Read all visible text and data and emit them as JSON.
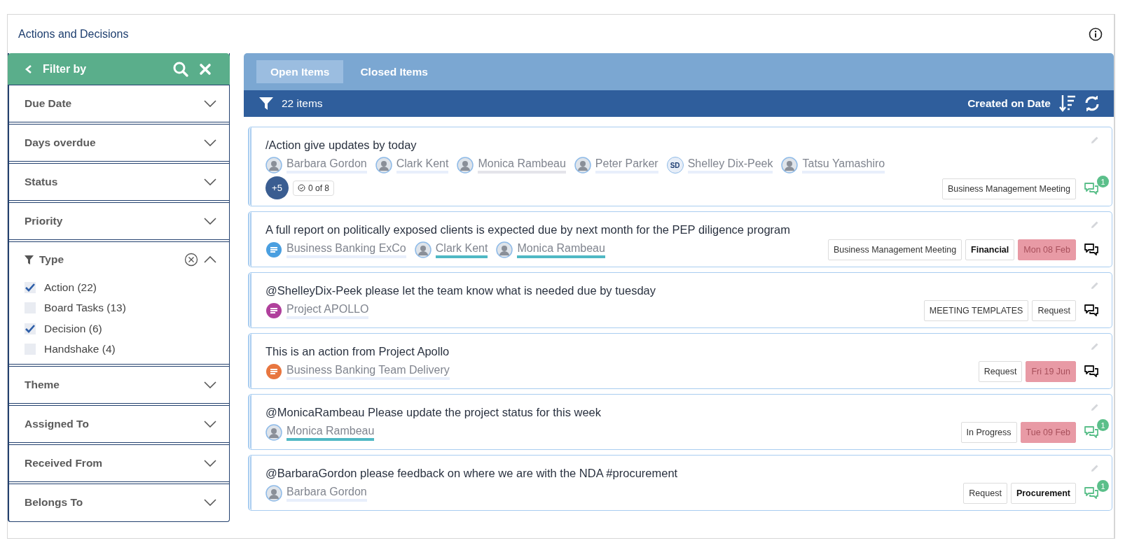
{
  "panel": {
    "title": "Actions and Decisions"
  },
  "filter": {
    "title": "Filter by",
    "sections": [
      {
        "label": "Due Date",
        "expanded": false
      },
      {
        "label": "Days overdue",
        "expanded": false
      },
      {
        "label": "Status",
        "expanded": false
      },
      {
        "label": "Priority",
        "expanded": false
      },
      {
        "label": "Type",
        "expanded": true,
        "options": [
          {
            "label": "Action (22)",
            "checked": true
          },
          {
            "label": "Board Tasks (13)",
            "checked": false
          },
          {
            "label": "Decision (6)",
            "checked": true
          },
          {
            "label": "Handshake (4)",
            "checked": false
          }
        ]
      },
      {
        "label": "Theme",
        "expanded": false
      },
      {
        "label": "Assigned To",
        "expanded": false
      },
      {
        "label": "Received From",
        "expanded": false
      },
      {
        "label": "Belongs To",
        "expanded": false
      }
    ]
  },
  "tabs": [
    {
      "label": "Open Items",
      "selected": true
    },
    {
      "label": "Closed Items",
      "selected": false
    }
  ],
  "toolbar": {
    "count": "22 items",
    "sort": "Created on Date"
  },
  "items": [
    {
      "title": "/Action give updates by today",
      "people": [
        {
          "kind": "person",
          "name": "Barbara Gordon",
          "color": "#e8effb"
        },
        {
          "kind": "person",
          "name": "Clark Kent",
          "color": "#e8effb"
        },
        {
          "kind": "person",
          "name": "Monica Rambeau",
          "color": "#e4e4ea"
        },
        {
          "kind": "person",
          "name": "Peter Parker",
          "color": "#e8effb"
        },
        {
          "kind": "initials",
          "initials": "SD",
          "name": "Shelley Dix-Peek",
          "color": "#e8effb"
        },
        {
          "kind": "person",
          "name": "Tatsu Yamashiro",
          "color": "#e8effb"
        }
      ],
      "more": "+5",
      "progress": "0 of 8",
      "tags": [
        {
          "label": "Business Management Meeting",
          "kind": "plain"
        }
      ],
      "comments": "1"
    },
    {
      "title": "A full report on politically exposed clients is expected due by next month for the PEP diligence program",
      "people": [
        {
          "kind": "group",
          "name": "Business Banking ExCo",
          "color": "#4a9fe0"
        },
        {
          "kind": "person",
          "name": "Clark Kent",
          "color": "#4fb8c4"
        },
        {
          "kind": "person",
          "name": "Monica Rambeau",
          "color": "#4fb8c4"
        }
      ],
      "tags": [
        {
          "label": "Business Management Meeting",
          "kind": "plain"
        },
        {
          "label": "Financial",
          "kind": "bold"
        },
        {
          "label": "Mon 08 Feb",
          "kind": "date"
        }
      ]
    },
    {
      "title": "@ShelleyDix-Peek  please let the team know what is needed due by tuesday",
      "people": [
        {
          "kind": "group",
          "name": "Project APOLLO",
          "color": "#b0409c"
        }
      ],
      "tags": [
        {
          "label": "MEETING TEMPLATES",
          "kind": "plain"
        },
        {
          "label": "Request",
          "kind": "plain"
        }
      ]
    },
    {
      "title": "This is an action from Project Apollo",
      "people": [
        {
          "kind": "group",
          "name": "Business Banking Team Delivery",
          "color": "#e8763f"
        }
      ],
      "tags": [
        {
          "label": "Request",
          "kind": "plain"
        },
        {
          "label": "Fri 19 Jun",
          "kind": "date"
        }
      ]
    },
    {
      "title": "@MonicaRambeau Please update the project status for this week",
      "people": [
        {
          "kind": "person",
          "name": "Monica Rambeau",
          "color": "#4fb8c4"
        }
      ],
      "tags": [
        {
          "label": "In Progress",
          "kind": "plain"
        },
        {
          "label": "Tue 09 Feb",
          "kind": "date"
        }
      ],
      "comments": "1"
    },
    {
      "title": "@BarbaraGordon please feedback on where we are with the NDA  #procurement",
      "people": [
        {
          "kind": "person",
          "name": "Barbara Gordon",
          "color": "#e8effb"
        }
      ],
      "tags": [
        {
          "label": "Request",
          "kind": "plain"
        },
        {
          "label": "Procurement",
          "kind": "bold"
        }
      ],
      "comments": "1"
    }
  ]
}
